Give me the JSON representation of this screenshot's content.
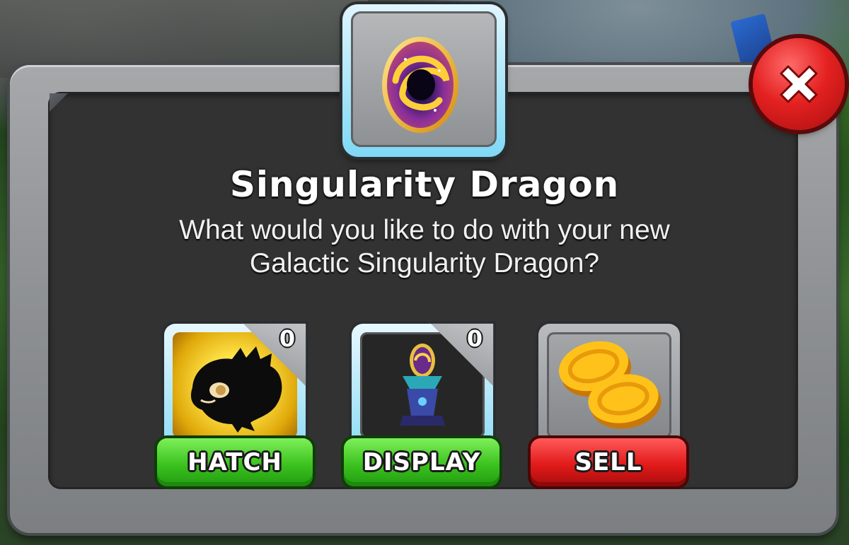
{
  "dialog": {
    "title": "Singularity Dragon",
    "message_line1": "What would you like to do with your new",
    "message_line2": "Galactic Singularity Dragon?",
    "egg_icon": "galactic-egg-icon",
    "close_icon": "close-x-icon"
  },
  "options": [
    {
      "id": "hatch",
      "label": "HATCH",
      "count": "0",
      "icon": "dragon-silhouette-icon",
      "button_color": "#3cc21f"
    },
    {
      "id": "display",
      "label": "DISPLAY",
      "count": "0",
      "icon": "egg-pedestal-icon",
      "button_color": "#3cc21f"
    },
    {
      "id": "sell",
      "label": "SELL",
      "icon": "gold-coins-icon",
      "button_color": "#e21a1a"
    }
  ],
  "colors": {
    "panel_frame": "#8e9194",
    "panel_inner": "#323232",
    "slot_highlight": "#7fd8f5",
    "close_red": "#e42121"
  }
}
